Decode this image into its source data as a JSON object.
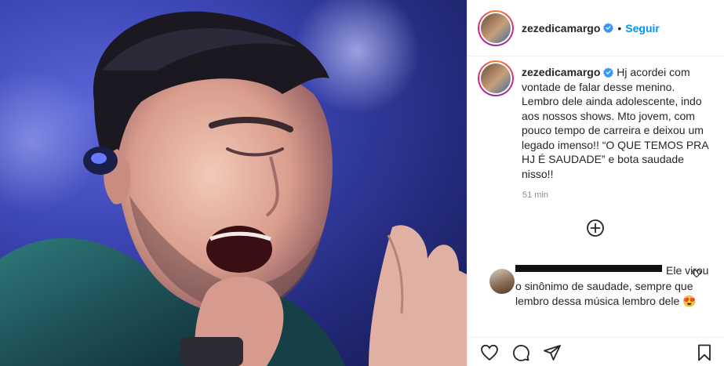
{
  "post": {
    "username": "zezedicamargo",
    "follow_label": "Seguir",
    "separator": "•",
    "caption": "Hj acordei com vontade de falar desse menino. Lembro dele ainda adolescente, indo aos nossos shows. Mto jovem, com pouco tempo de carreira e deixou um legado imenso!! “O QUE TEMOS PRA HJ É SAUDADE” e bota saudade nisso!!",
    "time": "51 min"
  },
  "comment": {
    "text_lead": "",
    "text_first": "Ele virou o",
    "text_rest": "sinônimo de saudade, sempre que lembro dessa música lembro dele",
    "emoji": "😍"
  },
  "icons": {
    "verified": "verified-badge-icon",
    "add": "plus-circle-icon",
    "like": "heart-icon",
    "comment": "comment-icon",
    "share": "paper-plane-icon",
    "save": "bookmark-icon"
  },
  "colors": {
    "link": "#0095f6",
    "verified": "#3897f0",
    "text": "#262626",
    "muted": "#8e8e8e"
  }
}
